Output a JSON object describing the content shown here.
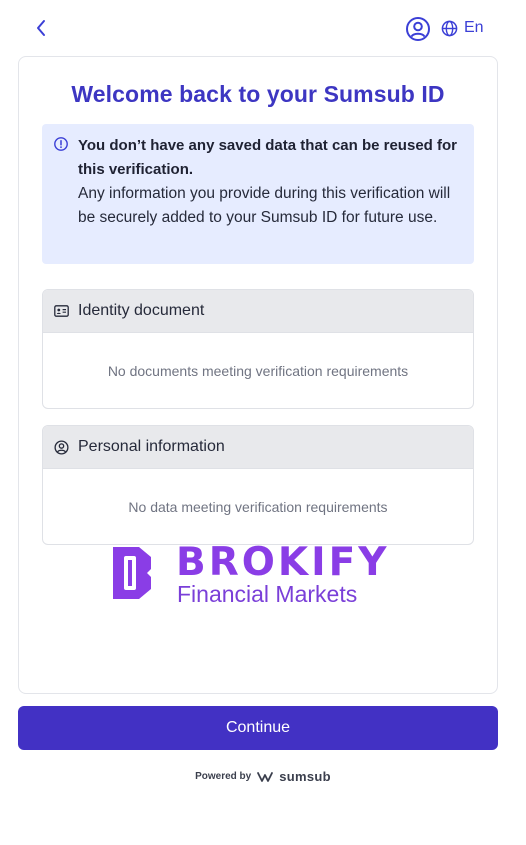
{
  "header": {
    "back_icon": "chevron-left-icon",
    "profile_icon": "user-circle-icon",
    "language_icon": "globe-icon",
    "language": "En",
    "accent_color": "#3b3fd6"
  },
  "card": {
    "title": "Welcome back to your Sumsub ID",
    "notice": {
      "icon": "info-icon",
      "title": "You don’t have any saved data that can be reused for this verification.",
      "body": "Any information you provide during this verification will be securely added to your Sumsub ID for future use.",
      "background": "#e6ecff"
    },
    "sections": [
      {
        "icon": "id-card-icon",
        "title": "Identity document",
        "empty_text": "No documents meeting verification requirements"
      },
      {
        "icon": "user-circle-icon",
        "title": "Personal information",
        "empty_text": "No data meeting verification requirements"
      }
    ],
    "logo": {
      "word": "BROKIFY",
      "subtitle": "Financial Markets",
      "color": "#8a3de6"
    }
  },
  "footer": {
    "continue_label": "Continue",
    "button_color": "#4231c4",
    "powered_by": "Powered by",
    "brand": "sumsub"
  }
}
